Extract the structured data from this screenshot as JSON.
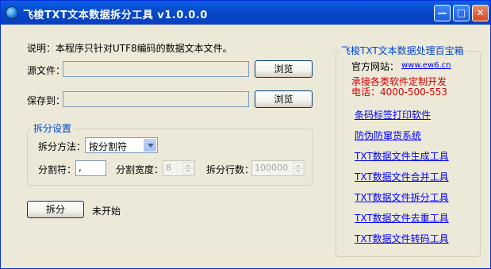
{
  "window": {
    "title": "飞梭TXT文本数据拆分工具 v1.0.0.0",
    "minimize": "—",
    "maximize": "□",
    "close": "✕"
  },
  "main": {
    "description": "说明：本程序只针对UTF8编码的数据文本文件。",
    "source_label": "源文件：",
    "source_value": "",
    "browse1": "浏览",
    "save_label": "保存到：",
    "save_value": "",
    "browse2": "浏览"
  },
  "split_settings": {
    "title": "拆分设置",
    "method_label": "拆分方法：",
    "method_value": "按分割符",
    "separator_label": "分割符：",
    "separator_value": ",",
    "width_label": "分割宽度：",
    "width_value": "8",
    "rows_label": "拆分行数：",
    "rows_value": "100000"
  },
  "actions": {
    "split_button": "拆分",
    "status": "未开始"
  },
  "right_panel": {
    "title": "飞梭TXT文本数据处理百宝箱",
    "site_label": "官方网站：",
    "site_url": "www.ew6.cn",
    "promo": "承接各类软件定制开发",
    "phone": "电话：4000-500-553",
    "links": [
      "条码标签打印软件",
      "防伪防窜货系统",
      "TXT数据文件生成工具",
      "TXT数据文件合并工具",
      "TXT数据文件拆分工具",
      "TXT数据文件去重工具",
      "TXT数据文件转码工具"
    ]
  }
}
